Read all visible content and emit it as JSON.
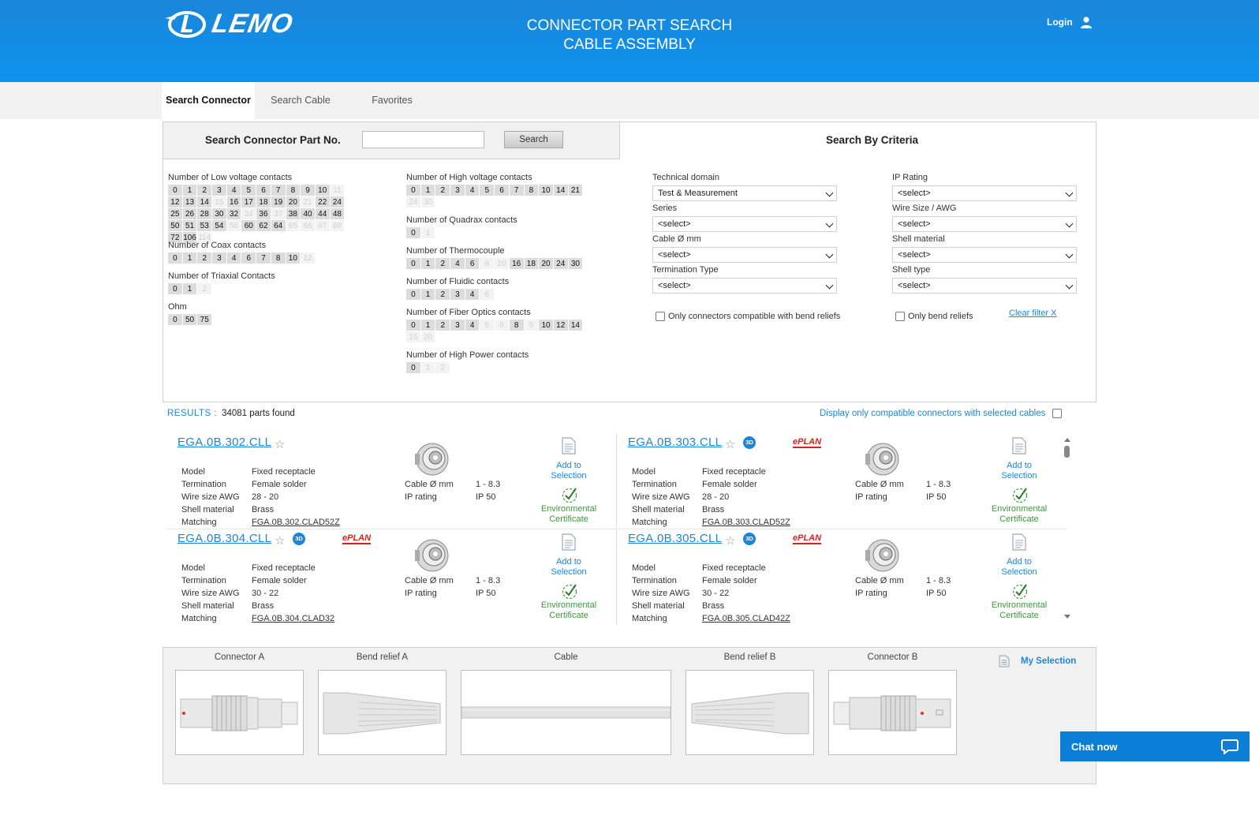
{
  "header": {
    "brand": "LEMO",
    "title_line1": "CONNECTOR PART SEARCH",
    "title_line2": "CABLE ASSEMBLY",
    "login": "Login"
  },
  "tabs": [
    "Search Connector",
    "Search Cable",
    "Favorites"
  ],
  "part_search": {
    "label": "Search Connector Part No.",
    "button": "Search",
    "value": ""
  },
  "criteria_title": "Search By Criteria",
  "contact_groups": {
    "low_voltage": {
      "label": "Number of Low voltage contacts",
      "chips": [
        {
          "v": "0",
          "on": true
        },
        {
          "v": "1",
          "on": true
        },
        {
          "v": "2",
          "on": true
        },
        {
          "v": "3",
          "on": true
        },
        {
          "v": "4",
          "on": true
        },
        {
          "v": "5",
          "on": true
        },
        {
          "v": "6",
          "on": true
        },
        {
          "v": "7",
          "on": true
        },
        {
          "v": "8",
          "on": true
        },
        {
          "v": "9",
          "on": true
        },
        {
          "v": "10",
          "on": true
        },
        {
          "v": "11",
          "on": false
        },
        {
          "v": "12",
          "on": true
        },
        {
          "v": "13",
          "on": true
        },
        {
          "v": "14",
          "on": true
        },
        {
          "v": "15",
          "on": false
        },
        {
          "v": "16",
          "on": true
        },
        {
          "v": "17",
          "on": true
        },
        {
          "v": "18",
          "on": true
        },
        {
          "v": "19",
          "on": true
        },
        {
          "v": "20",
          "on": true
        },
        {
          "v": "21",
          "on": false
        },
        {
          "v": "22",
          "on": true
        },
        {
          "v": "24",
          "on": true
        },
        {
          "v": "25",
          "on": true
        },
        {
          "v": "26",
          "on": true
        },
        {
          "v": "28",
          "on": true
        },
        {
          "v": "30",
          "on": true
        },
        {
          "v": "32",
          "on": true
        },
        {
          "v": "34",
          "on": false
        },
        {
          "v": "36",
          "on": true
        },
        {
          "v": "37",
          "on": false
        },
        {
          "v": "38",
          "on": true
        },
        {
          "v": "40",
          "on": true
        },
        {
          "v": "44",
          "on": true
        },
        {
          "v": "48",
          "on": true
        },
        {
          "v": "50",
          "on": true
        },
        {
          "v": "51",
          "on": true
        },
        {
          "v": "53",
          "on": true
        },
        {
          "v": "54",
          "on": true
        },
        {
          "v": "56",
          "on": false
        },
        {
          "v": "60",
          "on": true
        },
        {
          "v": "62",
          "on": true
        },
        {
          "v": "64",
          "on": true
        },
        {
          "v": "65",
          "on": false
        },
        {
          "v": "66",
          "on": false
        },
        {
          "v": "67",
          "on": false
        },
        {
          "v": "68",
          "on": false
        },
        {
          "v": "72",
          "on": true
        },
        {
          "v": "106",
          "on": true
        },
        {
          "v": "114",
          "on": false
        }
      ]
    },
    "coax": {
      "label": "Number of Coax contacts",
      "chips": [
        {
          "v": "0",
          "on": true
        },
        {
          "v": "1",
          "on": true
        },
        {
          "v": "2",
          "on": true
        },
        {
          "v": "3",
          "on": true
        },
        {
          "v": "4",
          "on": true
        },
        {
          "v": "6",
          "on": true
        },
        {
          "v": "7",
          "on": true
        },
        {
          "v": "8",
          "on": true
        },
        {
          "v": "10",
          "on": true
        },
        {
          "v": "12",
          "on": false
        }
      ]
    },
    "triaxial": {
      "label": "Number of Triaxial Contacts",
      "chips": [
        {
          "v": "0",
          "on": true
        },
        {
          "v": "1",
          "on": true
        },
        {
          "v": "2",
          "on": false
        }
      ]
    },
    "ohm": {
      "label": "Ohm",
      "chips": [
        {
          "v": "0",
          "on": true
        },
        {
          "v": "50",
          "on": true
        },
        {
          "v": "75",
          "on": true
        }
      ]
    },
    "high_voltage": {
      "label": "Number of High voltage contacts",
      "chips": [
        {
          "v": "0",
          "on": true
        },
        {
          "v": "1",
          "on": true
        },
        {
          "v": "2",
          "on": true
        },
        {
          "v": "3",
          "on": true
        },
        {
          "v": "4",
          "on": true
        },
        {
          "v": "5",
          "on": true
        },
        {
          "v": "6",
          "on": true
        },
        {
          "v": "7",
          "on": true
        },
        {
          "v": "8",
          "on": true
        },
        {
          "v": "10",
          "on": true
        },
        {
          "v": "14",
          "on": true
        },
        {
          "v": "21",
          "on": true
        },
        {
          "v": "24",
          "on": false
        },
        {
          "v": "30",
          "on": false
        }
      ]
    },
    "quadrax": {
      "label": "Number of Quadrax contacts",
      "chips": [
        {
          "v": "0",
          "on": true
        },
        {
          "v": "1",
          "on": false
        }
      ]
    },
    "thermocouple": {
      "label": "Number of Thermocouple",
      "chips": [
        {
          "v": "0",
          "on": true
        },
        {
          "v": "1",
          "on": true
        },
        {
          "v": "2",
          "on": true
        },
        {
          "v": "4",
          "on": true
        },
        {
          "v": "6",
          "on": true
        },
        {
          "v": "8",
          "on": false
        },
        {
          "v": "10",
          "on": false
        },
        {
          "v": "16",
          "on": true
        },
        {
          "v": "18",
          "on": true
        },
        {
          "v": "20",
          "on": true
        },
        {
          "v": "24",
          "on": true
        },
        {
          "v": "30",
          "on": true
        }
      ]
    },
    "fluidic": {
      "label": "Number of Fluidic contacts",
      "chips": [
        {
          "v": "0",
          "on": true
        },
        {
          "v": "1",
          "on": true
        },
        {
          "v": "2",
          "on": true
        },
        {
          "v": "3",
          "on": true
        },
        {
          "v": "4",
          "on": true
        },
        {
          "v": "6",
          "on": false
        }
      ]
    },
    "fiber_optics": {
      "label": "Number of Fiber Optics contacts",
      "chips": [
        {
          "v": "0",
          "on": true
        },
        {
          "v": "1",
          "on": true
        },
        {
          "v": "2",
          "on": true
        },
        {
          "v": "3",
          "on": true
        },
        {
          "v": "4",
          "on": true
        },
        {
          "v": "5",
          "on": false
        },
        {
          "v": "6",
          "on": false
        },
        {
          "v": "8",
          "on": true
        },
        {
          "v": "9",
          "on": false
        },
        {
          "v": "10",
          "on": true
        },
        {
          "v": "12",
          "on": true
        },
        {
          "v": "14",
          "on": true
        },
        {
          "v": "16",
          "on": false
        },
        {
          "v": "20",
          "on": false
        }
      ]
    },
    "high_power": {
      "label": "Number of High Power contacts",
      "chips": [
        {
          "v": "0",
          "on": true
        },
        {
          "v": "1",
          "on": false
        },
        {
          "v": "2",
          "on": false
        }
      ]
    }
  },
  "filters": {
    "technical_domain": {
      "label": "Technical domain",
      "value": "Test & Measurement"
    },
    "series": {
      "label": "Series",
      "value": "<select>"
    },
    "cable_diameter": {
      "label": "Cable Ø mm",
      "value": "<select>"
    },
    "termination_type": {
      "label": "Termination Type",
      "value": "<select>"
    },
    "ip_rating": {
      "label": "IP Rating",
      "value": "<select>"
    },
    "wire_size": {
      "label": "Wire Size / AWG",
      "value": "<select>"
    },
    "shell_material": {
      "label": "Shell material",
      "value": "<select>"
    },
    "shell_type": {
      "label": "Shell type",
      "value": "<select>"
    },
    "bend_compatible": "Only connectors compatible with bend reliefs",
    "only_bend_reliefs": "Only bend reliefs",
    "clear": "Clear filter X"
  },
  "results": {
    "label": "RESULTS :",
    "count": "34081 parts found",
    "compat_label": "Display only compatible connectors with selected cables"
  },
  "cards": [
    {
      "part": "EGA.0B.302.CLL",
      "badge_3d": false,
      "eplan": false,
      "model_k": "Model",
      "model": "Fixed receptacle",
      "term_k": "Termination",
      "term": "Female solder",
      "wire_k": "Wire size AWG",
      "wire": "28 - 20",
      "shell_k": "Shell material",
      "shell": "Brass",
      "match_k": "Matching",
      "match": "FGA.0B.302.CLAD52Z",
      "cable_k": "Cable Ø mm",
      "cable": "1 - 8.3",
      "ip_k": "IP rating",
      "ip": "IP 50",
      "add_l1": "Add to",
      "add_l2": "Selection",
      "env_l1": "Environmental",
      "env_l2": "Certificate"
    },
    {
      "part": "EGA.0B.303.CLL",
      "badge_3d": true,
      "eplan": true,
      "model_k": "Model",
      "model": "Fixed receptacle",
      "term_k": "Termination",
      "term": "Female solder",
      "wire_k": "Wire size AWG",
      "wire": "28 - 20",
      "shell_k": "Shell material",
      "shell": "Brass",
      "match_k": "Matching",
      "match": "FGA.0B.303.CLAD52Z",
      "cable_k": "Cable Ø mm",
      "cable": "1 - 8.3",
      "ip_k": "IP rating",
      "ip": "IP 50",
      "add_l1": "Add to",
      "add_l2": "Selection",
      "env_l1": "Environmental",
      "env_l2": "Certificate"
    },
    {
      "part": "EGA.0B.304.CLL",
      "badge_3d": true,
      "eplan": true,
      "model_k": "Model",
      "model": "Fixed receptacle",
      "term_k": "Termination",
      "term": "Female solder",
      "wire_k": "Wire size AWG",
      "wire": "30 - 22",
      "shell_k": "Shell material",
      "shell": "Brass",
      "match_k": "Matching",
      "match": "FGA.0B.304.CLAD32",
      "cable_k": "Cable Ø mm",
      "cable": "1 - 8.3",
      "ip_k": "IP rating",
      "ip": "IP 50",
      "add_l1": "Add to",
      "add_l2": "Selection",
      "env_l1": "Environmental",
      "env_l2": "Certificate"
    },
    {
      "part": "EGA.0B.305.CLL",
      "badge_3d": true,
      "eplan": true,
      "model_k": "Model",
      "model": "Fixed receptacle",
      "term_k": "Termination",
      "term": "Female solder",
      "wire_k": "Wire size AWG",
      "wire": "30 - 22",
      "shell_k": "Shell material",
      "shell": "Brass",
      "match_k": "Matching",
      "match": "FGA.0B.305.CLAD42Z",
      "cable_k": "Cable Ø mm",
      "cable": "1 - 8.3",
      "ip_k": "IP rating",
      "ip": "IP 50",
      "add_l1": "Add to",
      "add_l2": "Selection",
      "env_l1": "Environmental",
      "env_l2": "Certificate"
    }
  ],
  "badges": {
    "threed": "3D",
    "eplan": "ePLAN"
  },
  "configurator": {
    "connector_a": "Connector A",
    "bend_relief_a": "Bend relief A",
    "cable": "Cable",
    "bend_relief_b": "Bend relief B",
    "connector_b": "Connector B",
    "my_selection": "My Selection"
  },
  "chat": "Chat now",
  "colors": {
    "brand_blue": "#1b86d9",
    "env_green": "#3a9a3a",
    "eplan_red": "#d8201c"
  }
}
